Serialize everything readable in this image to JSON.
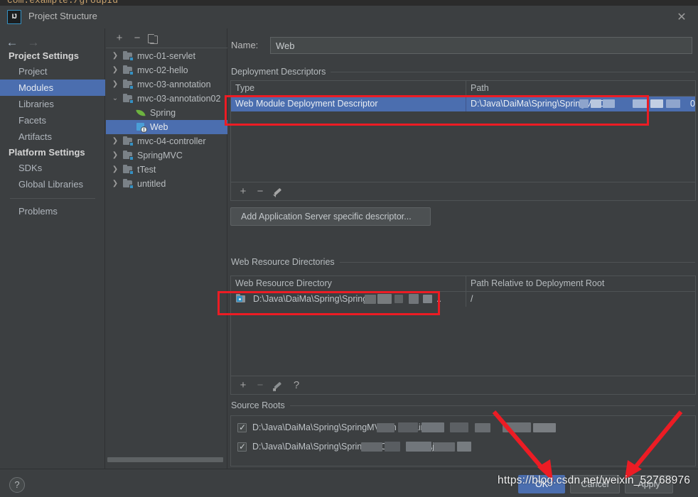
{
  "background": {
    "code_sliver": "com.example./groupId"
  },
  "window": {
    "title": "Project Structure",
    "logo_text": "IJ",
    "close_icon": "close-icon"
  },
  "nav": {
    "back_icon": "←",
    "forward_icon": "→",
    "groups": [
      {
        "title": "Project Settings",
        "items": [
          {
            "label": "Project",
            "selected": false
          },
          {
            "label": "Modules",
            "selected": true
          },
          {
            "label": "Libraries",
            "selected": false
          },
          {
            "label": "Facets",
            "selected": false
          },
          {
            "label": "Artifacts",
            "selected": false
          }
        ]
      },
      {
        "title": "Platform Settings",
        "items": [
          {
            "label": "SDKs",
            "selected": false
          },
          {
            "label": "Global Libraries",
            "selected": false
          }
        ]
      }
    ],
    "problems": {
      "label": "Problems",
      "selected": false
    }
  },
  "tree": {
    "toolbar": {
      "add": "+",
      "remove": "−",
      "copy": "copy-icon"
    },
    "nodes": [
      {
        "label": "mvc-01-servlet",
        "indent": 0,
        "chevron": "collapsed",
        "icon": "module-folder-icon",
        "selected": false
      },
      {
        "label": "mvc-02-hello",
        "indent": 0,
        "chevron": "collapsed",
        "icon": "module-folder-icon",
        "selected": false
      },
      {
        "label": "mvc-03-annotation",
        "indent": 0,
        "chevron": "collapsed",
        "icon": "module-folder-icon",
        "selected": false
      },
      {
        "label": "mvc-03-annotation02",
        "indent": 0,
        "chevron": "expanded",
        "icon": "module-folder-icon",
        "selected": false
      },
      {
        "label": "Spring",
        "indent": 1,
        "chevron": "none",
        "icon": "spring-leaf-icon",
        "selected": false
      },
      {
        "label": "Web",
        "indent": 1,
        "chevron": "none",
        "icon": "web-facet-icon",
        "selected": true
      },
      {
        "label": "mvc-04-controller",
        "indent": 0,
        "chevron": "collapsed",
        "icon": "module-folder-icon",
        "selected": false
      },
      {
        "label": "SpringMVC",
        "indent": 0,
        "chevron": "collapsed",
        "icon": "module-folder-icon",
        "selected": false
      },
      {
        "label": "tTest",
        "indent": 0,
        "chevron": "collapsed",
        "icon": "module-folder-icon",
        "selected": false
      },
      {
        "label": "untitled",
        "indent": 0,
        "chevron": "collapsed",
        "icon": "module-folder-icon",
        "selected": false
      }
    ]
  },
  "facet": {
    "name_label": "Name:",
    "name_value": "Web",
    "deployment": {
      "section_title": "Deployment Descriptors",
      "columns": [
        "Type",
        "Path"
      ],
      "rows": [
        {
          "type": "Web Module Deployment Descriptor",
          "path": "D:\\Java\\DaiMa\\Spring\\SpringMVC",
          "path_suffix": "0",
          "selected": true
        }
      ],
      "toolbar": {
        "add": "+",
        "remove": "−",
        "edit": "pencil-icon"
      },
      "add_server_descriptor_button": "Add Application Server specific descriptor..."
    },
    "web_resources": {
      "section_title": "Web Resource Directories",
      "columns": [
        "Web Resource Directory",
        "Path Relative to Deployment Root"
      ],
      "rows": [
        {
          "directory": "D:\\Java\\DaiMa\\Spring\\SpringM",
          "directory_tail": "..",
          "relative_path": "/"
        }
      ],
      "toolbar": {
        "add": "+",
        "remove": "−",
        "edit": "pencil-icon",
        "help": "?"
      }
    },
    "source_roots": {
      "section_title": "Source Roots",
      "rows": [
        {
          "checked": true,
          "path": "D:\\Java\\DaiMa\\Spring\\SpringMVC\\m",
          "path_tail": "\\main"
        },
        {
          "checked": true,
          "path": "D:\\Java\\DaiMa\\Spring\\SpringMVC\\",
          "path_tail": "ain\\jav"
        }
      ]
    }
  },
  "footer": {
    "help_icon": "?",
    "buttons": [
      {
        "label": "OK",
        "primary": true
      },
      {
        "label": "Cancel",
        "primary": false
      },
      {
        "label": "Apply",
        "primary": false
      }
    ]
  },
  "watermark": {
    "text": "https://blog.csdn.net/weixin_52768976"
  },
  "annotations": {
    "boxes": [
      {
        "name": "deployment-descriptor-highlight"
      },
      {
        "name": "web-resource-directory-highlight"
      }
    ],
    "arrows": [
      {
        "name": "arrow-to-ok-button"
      },
      {
        "name": "arrow-to-apply-button"
      }
    ],
    "color": "#ec1c24"
  },
  "colors": {
    "window_bg": "#3c3f41",
    "selection_blue": "#4b6eaf",
    "accent_blue": "#3592c4",
    "spring_green": "#6db33f",
    "annotation_red": "#ec1c24",
    "text": "#bbbbbb"
  }
}
